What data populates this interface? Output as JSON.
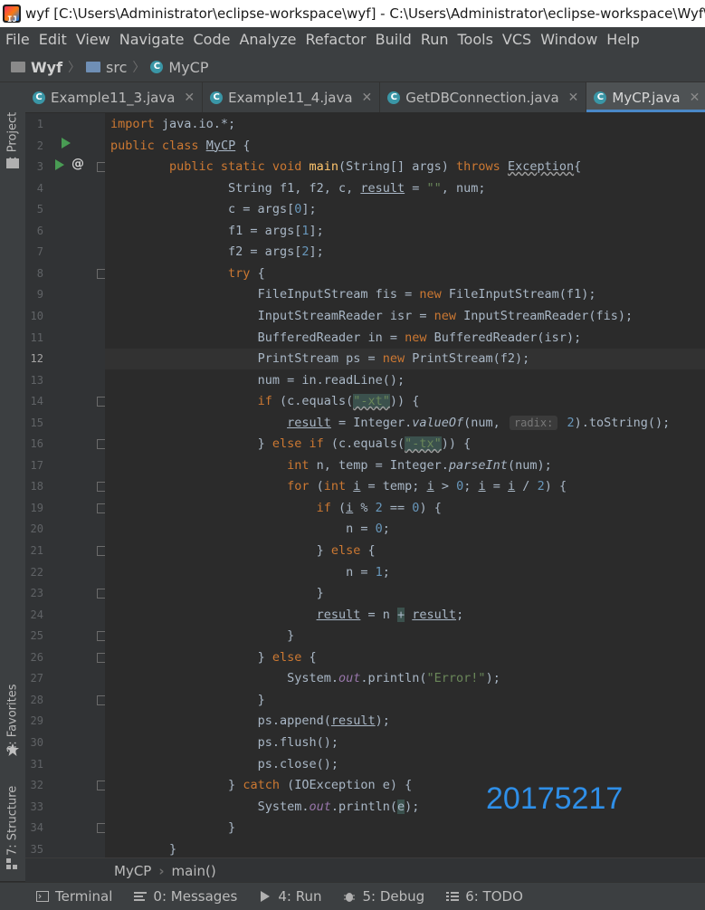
{
  "window": {
    "title": "wyf [C:\\Users\\Administrator\\eclipse-workspace\\wyf] - C:\\Users\\Administrator\\eclipse-workspace\\Wyf\\sr"
  },
  "menu": [
    "File",
    "Edit",
    "View",
    "Navigate",
    "Code",
    "Analyze",
    "Refactor",
    "Build",
    "Run",
    "Tools",
    "VCS",
    "Window",
    "Help"
  ],
  "nav": {
    "project": "Wyf",
    "folder": "src",
    "file": "MyCP"
  },
  "tabs": [
    {
      "label": "Example11_3.java"
    },
    {
      "label": "Example11_4.java"
    },
    {
      "label": "GetDBConnection.java"
    },
    {
      "label": "MyCP.java"
    }
  ],
  "left_tools": {
    "project": "1: Project",
    "favorites": "2: Favorites",
    "structure": "7: Structure"
  },
  "current_line": 12,
  "line_numbers": [
    "1",
    "2",
    "3",
    "4",
    "5",
    "6",
    "7",
    "8",
    "9",
    "10",
    "11",
    "12",
    "13",
    "14",
    "15",
    "16",
    "17",
    "18",
    "19",
    "20",
    "21",
    "22",
    "23",
    "24",
    "25",
    "26",
    "27",
    "28",
    "29",
    "30",
    "31",
    "32",
    "33",
    "34",
    "35"
  ],
  "code": {
    "l1": [
      "import",
      " java.io.*;"
    ],
    "l2": [
      "public class",
      " ",
      "MyCP",
      " {"
    ],
    "l3": [
      "public static void",
      " ",
      "main",
      "(String[] args) ",
      "throws",
      " ",
      "Exception",
      "{"
    ],
    "l4": [
      "String f1, f2, c, ",
      "result",
      " = ",
      "\"\"",
      ", num;"
    ],
    "l5": [
      "c = args[",
      "0",
      "];"
    ],
    "l6": [
      "f1 = args[",
      "1",
      "];"
    ],
    "l7": [
      "f2 = args[",
      "2",
      "];"
    ],
    "l8": [
      "try",
      " {"
    ],
    "l9": [
      "FileInputStream fis = ",
      "new",
      " FileInputStream(f1);"
    ],
    "l10": [
      "InputStreamReader isr = ",
      "new",
      " InputStreamReader(fis);"
    ],
    "l11": [
      "BufferedReader in = ",
      "new",
      " BufferedReader(isr);"
    ],
    "l12": [
      "PrintStream ps = ",
      "new",
      " PrintStream(f2);"
    ],
    "l13": [
      "num = in.readLine();"
    ],
    "l14": [
      "if",
      " (c.equals(",
      "\"-xt\"",
      ")) {"
    ],
    "l15": [
      "result",
      " = Integer.",
      "valueOf",
      "(num, ",
      "radix:",
      " ",
      "2",
      ").toString();"
    ],
    "l16": [
      "} ",
      "else if",
      " (c.equals(",
      "\"-tx\"",
      ")) {"
    ],
    "l17": [
      "int",
      " n, temp = Integer.",
      "parseInt",
      "(num);"
    ],
    "l18": [
      "for",
      " (",
      "int",
      " ",
      "i",
      " = temp; ",
      "i",
      " > ",
      "0",
      "; ",
      "i",
      " = ",
      "i",
      " / ",
      "2",
      ") {"
    ],
    "l19": [
      "if",
      " (",
      "i",
      " % ",
      "2",
      " == ",
      "0",
      ") {"
    ],
    "l20": [
      "n = ",
      "0",
      ";"
    ],
    "l21": [
      "} ",
      "else",
      " {"
    ],
    "l22": [
      "n = ",
      "1",
      ";"
    ],
    "l23": [
      "}"
    ],
    "l24": [
      "result",
      " = n ",
      "+",
      " ",
      "result",
      ";"
    ],
    "l25": [
      "}"
    ],
    "l26": [
      "} ",
      "else",
      " {"
    ],
    "l27": [
      "System.",
      "out",
      ".println(",
      "\"Error!\"",
      ");"
    ],
    "l28": [
      "}"
    ],
    "l29": [
      "ps.append(",
      "result",
      ");"
    ],
    "l30": [
      "ps.flush();"
    ],
    "l31": [
      "ps.close();"
    ],
    "l32": [
      "} ",
      "catch",
      " (IOException e) {"
    ],
    "l33": [
      "System.",
      "out",
      ".println(",
      "e",
      ");"
    ],
    "l34": [
      "}"
    ],
    "l35": [
      "}"
    ]
  },
  "watermark": "20175217",
  "breadcrumbs": {
    "class": "MyCP",
    "method": "main()"
  },
  "bottom_tools": [
    {
      "label": "Terminal",
      "icon": "terminal-icon"
    },
    {
      "label": "0: Messages",
      "icon": "messages-icon"
    },
    {
      "label": "4: Run",
      "icon": "run-icon"
    },
    {
      "label": "5: Debug",
      "icon": "debug-icon"
    },
    {
      "label": "6: TODO",
      "icon": "todo-icon"
    }
  ],
  "colors": {
    "keyword": "#cc7832",
    "string": "#6a8759",
    "number": "#6897bb",
    "field": "#9876aa",
    "method_decl": "#ffc66d",
    "watermark": "#2f8fe8",
    "run_green": "#499c54",
    "tab_accent": "#4a88c7"
  }
}
